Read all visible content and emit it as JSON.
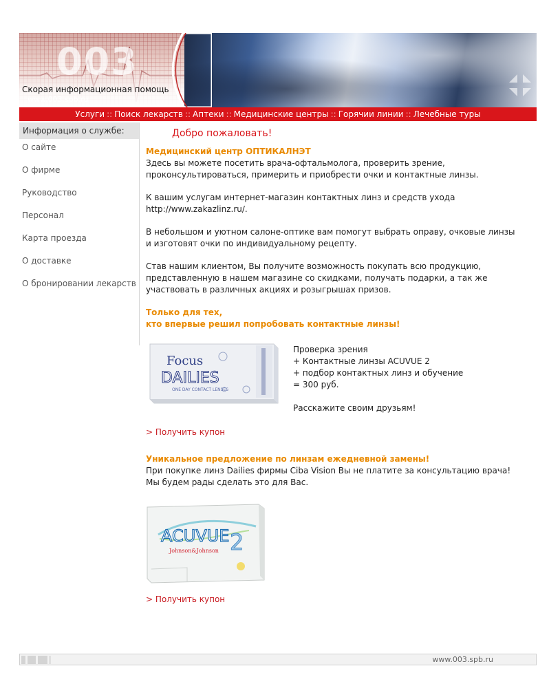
{
  "header": {
    "logo_text": "003",
    "subtitle": "Скорая  информационная помощь",
    "url": "www.003.spb.ru"
  },
  "nav": {
    "items": [
      "Услуги",
      "Поиск лекарств",
      "Аптеки",
      "Медицинские центры",
      "Горячии линии",
      "Лечебные туры"
    ],
    "separator": "::"
  },
  "sidebar": {
    "heading": "Информация о службе:",
    "items": [
      "О сайте",
      "О фирме",
      "Руководство",
      "Персонал",
      "Карта проезда",
      "О доставке",
      "О бронировании лекарств"
    ]
  },
  "main": {
    "welcome": "Добро пожаловать!",
    "center_title": "Медицинский центр ОПТИКАЛНЭТ",
    "para1_line1": "Здесь вы можете посетить врача-офтальмолога, проверить зрение,",
    "para1_line2": "проконсультироваться, примерить и приобрести очки и контактные линзы.",
    "para2_line1": "К вашим услугам интернет-магазин контактных линз и средств ухода",
    "para2_line2": "http://www.zakazlinz.ru/.",
    "para3_line1": "В небольшом и уютном салоне-оптике вам помогут выбрать оправу, очковые линзы",
    "para3_line2": "и изготовят очки по индивидуальному рецепту.",
    "para4_line1": "Став нашим клиентом, Вы получите возможность покупать всю продукцию,",
    "para4_line2": "представленную в нашем магазине со скидками, получать подарки, а так же",
    "para4_line3": "участвовать в различных акциях и розыгрышах призов.",
    "promo1_title_line1": "Только для тех,",
    "promo1_title_line2": "кто впервые решил попробовать контактные линзы!",
    "offer1_line1": "Проверка зрения",
    "offer1_line2": "+ Контактные линзы ACUVUE 2",
    "offer1_line3": "+ подбор контактных линз и обучение",
    "offer1_line4": "= 300 руб.",
    "offer1_share": "Расскажите своим друзьям!",
    "coupon_label": "> Получить купон",
    "promo2_title": "Уникальное предложение по линзам ежедневной замены!",
    "promo2_line1": "При покупке линз Dailies фирмы Ciba Vision Вы не платите за консультацию врача!",
    "promo2_line2": "Мы будем рады сделать это для Вас."
  },
  "product1": {
    "brand": "Focus",
    "name": "DAILIES",
    "tagline": "ONE DAY CONTACT LENSES"
  },
  "product2": {
    "name": "ACUVUE",
    "number": "2",
    "maker": "Johnson&Johnson"
  },
  "footer": {
    "url": "www.003.spb.ru"
  },
  "colors": {
    "nav_red": "#d9161b",
    "promo_orange": "#e98a00",
    "link_red": "#c8191f"
  }
}
